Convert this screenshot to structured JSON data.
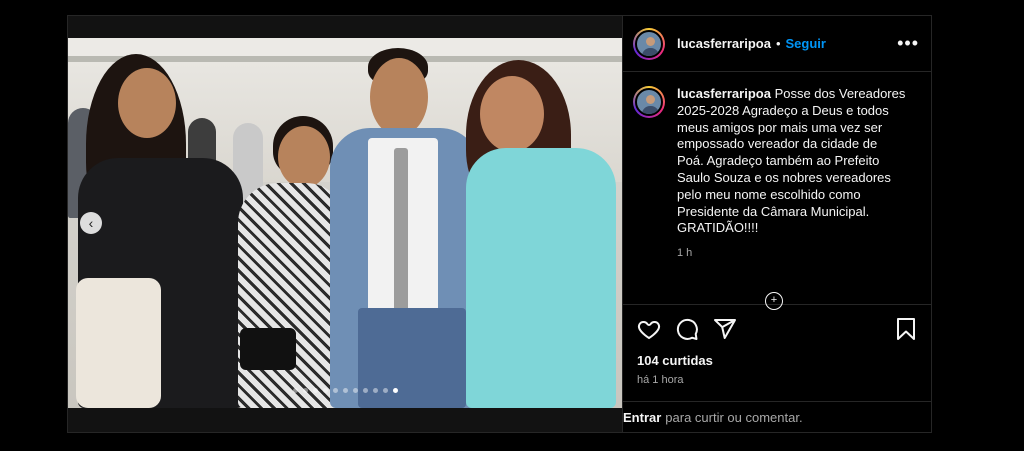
{
  "header": {
    "username": "lucasferraripoa",
    "separator": "•",
    "follow_label": "Seguir",
    "more_label": "•••"
  },
  "caption": {
    "username": "lucasferraripoa",
    "text": "Posse dos Vereadores 2025-2028 Agradeço a Deus e todos meus amigos por mais uma vez ser empossado vereador da cidade de Poá. Agradeço também ao Prefeito Saulo Souza e os nobres vereadores pelo meu nome escolhido como Presidente da Câmara Municipal. GRATIDÃO!!!!",
    "time": "1 h"
  },
  "actions": {
    "likes": "104 curtidas",
    "ago": "há 1 hora"
  },
  "comment": {
    "login_label": "Entrar",
    "prompt": "para curtir ou comentar."
  },
  "carousel": {
    "slide_count": 11,
    "active_index": 10,
    "prev_glyph": "‹"
  }
}
